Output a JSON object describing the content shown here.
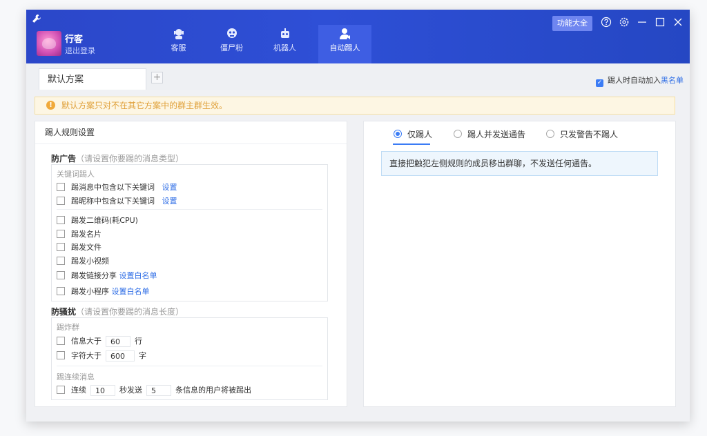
{
  "user": {
    "name": "行客",
    "logout": "退出登录"
  },
  "nav": [
    {
      "label": "客服",
      "icon": "customer-service-icon"
    },
    {
      "label": "僵尸粉",
      "icon": "zombie-fan-icon"
    },
    {
      "label": "机器人",
      "icon": "robot-icon"
    },
    {
      "label": "自动踢人",
      "icon": "kick-user-icon",
      "active": true
    }
  ],
  "titlebar": {
    "features_button": "功能大全"
  },
  "tabs": {
    "default": "默认方案",
    "add": "+"
  },
  "blacklist_option": {
    "text": "踢人时自动加入",
    "link": "黑名单",
    "checked": true
  },
  "notice": "默认方案只对不在其它方案中的群主群生效。",
  "left_panel": {
    "title": "踢人规则设置",
    "anti_ad": {
      "title": "防广告",
      "hint": "（请设置你要踢的消息类型）",
      "keyword_group": "关键词踢人",
      "items": {
        "msg_keyword": "踢消息中包含以下关键词",
        "nick_keyword": "踢昵称中包含以下关键词",
        "qrcode": "踢发二维码(耗CPU)",
        "card": "踢发名片",
        "file": "踢发文件",
        "video": "踢发小视频",
        "link": "踢发链接分享",
        "miniprogram": "踢发小程序"
      },
      "set_link": "设置",
      "whitelist_link": "设置白名单"
    },
    "anti_spam": {
      "title": "防骚扰",
      "hint": "（请设置你要踢的消息长度）",
      "bomb_group": "踢炸群",
      "info_prefix": "信息大于",
      "info_value": "60",
      "info_unit": "行",
      "char_prefix": "字符大于",
      "char_value": "600",
      "char_unit": "字",
      "continuous_group": "踢连续消息",
      "cont_prefix": "连续",
      "cont_seconds": "10",
      "cont_mid": "秒发送",
      "cont_count": "5",
      "cont_suffix": "条信息的用户将被踢出"
    }
  },
  "right_panel": {
    "options": [
      "仅踢人",
      "踢人并发送通告",
      "只发警告不踢人"
    ],
    "selected": 0,
    "description": "直接把触犯左侧规则的成员移出群聊，不发送任何通告。"
  },
  "colors": {
    "titlebar": "#2b47c9",
    "accent": "#3b7cf5",
    "notice_text": "#e0a13b"
  }
}
